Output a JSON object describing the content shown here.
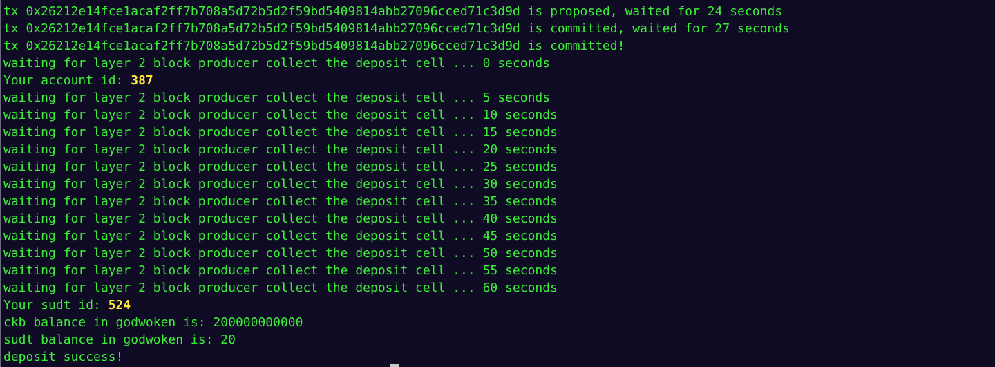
{
  "terminal": {
    "lines": [
      {
        "text": "tx 0x26212e14fce1acaf2ff7b708a5d72b5d2f59bd5409814abb27096cced71c3d9d is proposed, waited for 24 seconds"
      },
      {
        "text": "tx 0x26212e14fce1acaf2ff7b708a5d72b5d2f59bd5409814abb27096cced71c3d9d is committed, waited for 27 seconds"
      },
      {
        "text": "tx 0x26212e14fce1acaf2ff7b708a5d72b5d2f59bd5409814abb27096cced71c3d9d is committed!"
      },
      {
        "text": "waiting for layer 2 block producer collect the deposit cell ... 0 seconds"
      },
      {
        "prefix": "Your account id: ",
        "value": "387"
      },
      {
        "text": "waiting for layer 2 block producer collect the deposit cell ... 5 seconds"
      },
      {
        "text": "waiting for layer 2 block producer collect the deposit cell ... 10 seconds"
      },
      {
        "text": "waiting for layer 2 block producer collect the deposit cell ... 15 seconds"
      },
      {
        "text": "waiting for layer 2 block producer collect the deposit cell ... 20 seconds"
      },
      {
        "text": "waiting for layer 2 block producer collect the deposit cell ... 25 seconds"
      },
      {
        "text": "waiting for layer 2 block producer collect the deposit cell ... 30 seconds"
      },
      {
        "text": "waiting for layer 2 block producer collect the deposit cell ... 35 seconds"
      },
      {
        "text": "waiting for layer 2 block producer collect the deposit cell ... 40 seconds"
      },
      {
        "text": "waiting for layer 2 block producer collect the deposit cell ... 45 seconds"
      },
      {
        "text": "waiting for layer 2 block producer collect the deposit cell ... 50 seconds"
      },
      {
        "text": "waiting for layer 2 block producer collect the deposit cell ... 55 seconds"
      },
      {
        "text": "waiting for layer 2 block producer collect the deposit cell ... 60 seconds"
      },
      {
        "prefix": "Your sudt id: ",
        "value": "524"
      },
      {
        "text": "ckb balance in godwoken is: 200000000000"
      },
      {
        "text": "sudt balance in godwoken is: 20"
      },
      {
        "text": "deposit success!"
      }
    ]
  },
  "colors": {
    "background": "#0f0b24",
    "text": "#3dee39",
    "highlight": "#ffe93a"
  }
}
